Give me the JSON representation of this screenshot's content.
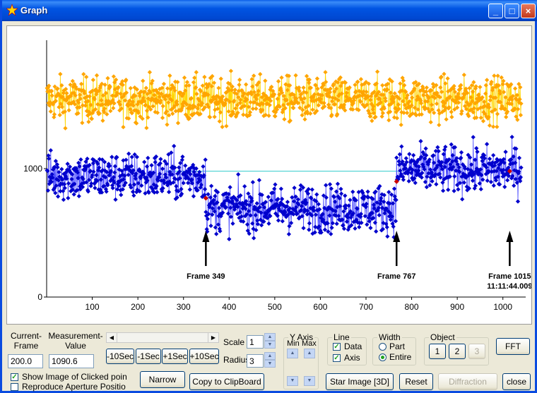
{
  "window": {
    "title": "Graph",
    "controls": {
      "minimize": "_",
      "maximize": "□",
      "close": "×"
    }
  },
  "chart_data": {
    "type": "scatter",
    "xlim": [
      0,
      1050
    ],
    "ylim": [
      0,
      2000
    ],
    "x_ticks": [
      100,
      200,
      300,
      400,
      500,
      600,
      700,
      800,
      900,
      1000
    ],
    "y_ticks": [
      0,
      1000
    ],
    "series": [
      {
        "color": "#ffa500",
        "line_color": "#ffd700",
        "mean": 1540,
        "spread": 170,
        "frames": [
          1,
          1040
        ]
      },
      {
        "color": "#0000cc",
        "line_color": "#5050ff",
        "mean_segments": [
          [
            1,
            349,
            940
          ],
          [
            349,
            767,
            690
          ],
          [
            767,
            1040,
            990
          ]
        ],
        "spread": 180,
        "frames": [
          1,
          1040
        ]
      }
    ],
    "reference_line": {
      "y": 980,
      "x_start": 260,
      "x_end": 780,
      "color": "#33cccc"
    },
    "highlight_points": [
      {
        "x": 349,
        "y": 770
      },
      {
        "x": 767,
        "y": 900
      },
      {
        "x": 1015,
        "y": 980
      }
    ],
    "annotations": [
      {
        "label": "Frame 349",
        "sublabel": "",
        "x": 349
      },
      {
        "label": "Frame 767",
        "sublabel": "",
        "x": 767
      },
      {
        "label": "Frame 1015",
        "sublabel": "11:11:44.009",
        "x": 1015
      }
    ]
  },
  "controls": {
    "current_frame_label": "Current-\nFrame",
    "current_frame_value": "200.0",
    "measurement_label": "Measurement-\nValue",
    "measurement_value": "1090.6",
    "btn_minus10": "-10Sec",
    "btn_minus1": "-1Sec",
    "btn_plus1": "+1Sec",
    "btn_plus10": "+10Sec",
    "scale_label": "Scale",
    "scale_value": "1",
    "radius_label": "Radius",
    "radius_value": "3",
    "yaxis_label": "Y Axis",
    "min_label": "Min",
    "max_label": "Max",
    "line_label": "Line",
    "data_label": "Data",
    "axis_label": "Axis",
    "width_label": "Width",
    "part_label": "Part",
    "entire_label": "Entire",
    "object_label": "Object",
    "obj1": "1",
    "obj2": "2",
    "obj3": "3",
    "fft": "FFT",
    "show_image_label": "Show Image of Clicked poin",
    "reproduce_label": "Reproduce Aperture Positio",
    "narrow": "Narrow",
    "copy_clipboard": "Copy to ClipBoard",
    "star_image": "Star Image [3D]",
    "reset": "Reset",
    "diffraction": "Diffraction",
    "close": "close"
  }
}
